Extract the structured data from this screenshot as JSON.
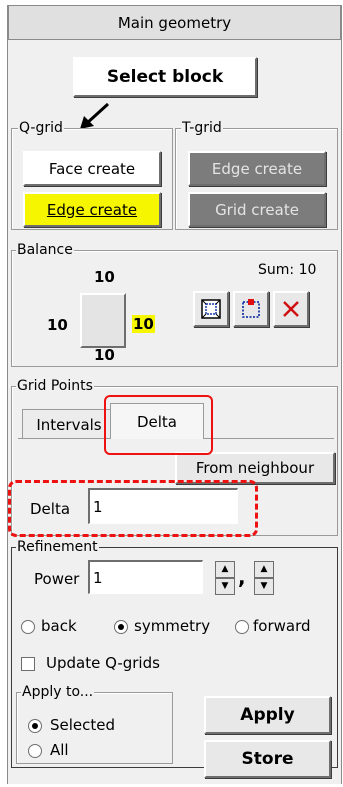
{
  "header": {
    "title": "Main geometry"
  },
  "select_block": {
    "label": "Select block"
  },
  "qgrid": {
    "legend": "Q-grid",
    "face_create": "Face create",
    "edge_create": "Edge create"
  },
  "tgrid": {
    "legend": "T-grid",
    "edge_create": "Edge create",
    "grid_create": "Grid create"
  },
  "balance": {
    "legend": "Balance",
    "top": "10",
    "left": "10",
    "right": "10",
    "bottom": "10",
    "sum": "Sum: 10"
  },
  "grid_points": {
    "legend": "Grid Points",
    "tabs": [
      "Intervals",
      "Delta"
    ],
    "from_neighbour": "From neighbour",
    "delta_label": "Delta",
    "delta_value": "1"
  },
  "refinement": {
    "legend": "Refinement",
    "power_label": "Power",
    "power_value": "1",
    "comma": ",",
    "options": [
      "back",
      "symmetry",
      "forward"
    ],
    "selected": "symmetry",
    "update_qgrids": "Update Q-grids"
  },
  "apply_to": {
    "legend": "Apply to...",
    "options": [
      "Selected",
      "All"
    ],
    "selected": "Selected"
  },
  "actions": {
    "apply": "Apply",
    "store": "Store"
  },
  "colors": {
    "highlight_yellow": "#f6f600",
    "annotation_red": "#ee1111",
    "dark_button": "#7c7c7c"
  }
}
